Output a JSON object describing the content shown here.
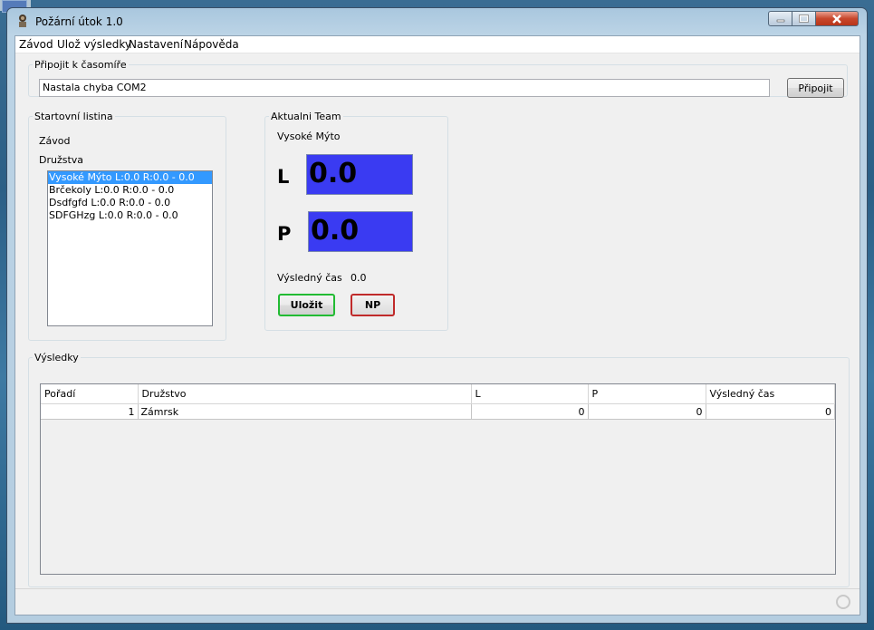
{
  "window": {
    "title": "Požární útok 1.0"
  },
  "menu": [
    "Závod",
    "Ulož výsledky",
    "Nastavení",
    "Nápověda"
  ],
  "connect": {
    "legend": "Připojit k časomíře",
    "status_value": "Nastala chyba COM2",
    "button_label": "Připojit"
  },
  "start_list": {
    "legend": "Startovní listina",
    "race_label": "Závod",
    "teams_label": "Družstva",
    "items": [
      "Vysoké Mýto L:0.0 R:0.0 - 0.0",
      "Brčekoly L:0.0 R:0.0 - 0.0",
      "Dsdfgfd L:0.0 R:0.0 - 0.0",
      "SDFGHzg L:0.0 R:0.0 - 0.0"
    ],
    "selected_index": 0
  },
  "current_team": {
    "legend": "Aktualni Team",
    "name": "Vysoké Mýto",
    "left_label": "L",
    "left_value": "0.0",
    "right_label": "P",
    "right_value": "0.0",
    "result_label": "Výsledný čas",
    "result_value": "0.0",
    "save_label": "Uložit",
    "np_label": "NP",
    "colors": {
      "time_box": "#3a3bf2",
      "save_border": "#22bb33",
      "np_border": "#c02a2a"
    }
  },
  "results": {
    "legend": "Výsledky",
    "columns": [
      "Pořadí",
      "Družstvo",
      "L",
      "P",
      "Výsledný čas"
    ],
    "rows": [
      [
        "1",
        "Zámrsk",
        "0",
        "0",
        "0"
      ]
    ]
  }
}
